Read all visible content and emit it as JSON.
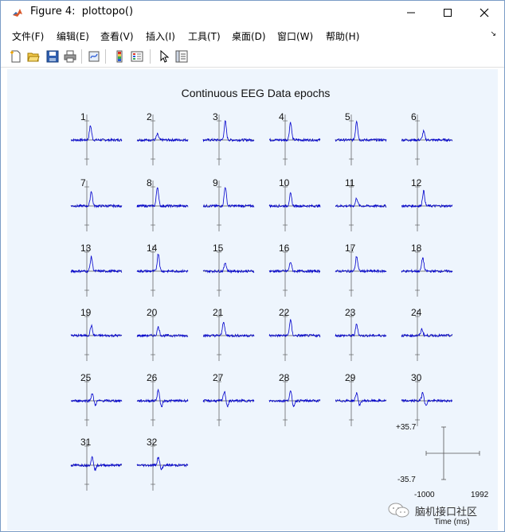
{
  "window": {
    "title": "Figure 4:  plottopo()",
    "controls": [
      "minimize",
      "maximize",
      "close"
    ]
  },
  "menu": {
    "items": [
      "文件(F)",
      "编辑(E)",
      "查看(V)",
      "插入(I)",
      "工具(T)",
      "桌面(D)",
      "窗口(W)",
      "帮助(H)"
    ],
    "overflow_arrow": "↘"
  },
  "toolbar": {
    "buttons": [
      "new-figure-icon",
      "open-icon",
      "save-icon",
      "print-icon",
      "link-icon",
      "colorbar-icon",
      "legend-icon",
      "pointer-icon",
      "property-editor-icon"
    ]
  },
  "figure": {
    "title": "Continuous EEG Data epochs",
    "channels": [
      "1",
      "2",
      "3",
      "4",
      "5",
      "6",
      "7",
      "8",
      "9",
      "10",
      "11",
      "12",
      "13",
      "14",
      "15",
      "16",
      "17",
      "18",
      "19",
      "20",
      "21",
      "22",
      "23",
      "24",
      "25",
      "26",
      "27",
      "28",
      "29",
      "30",
      "31",
      "32"
    ],
    "trace_color": "#0000cc",
    "axis_color": "#555555",
    "scale": {
      "y_max": "+35.7",
      "y_min": "-35.7",
      "x_min": "-1000",
      "x_max": "1992",
      "x_label": "Time (ms)"
    }
  },
  "chart_data": {
    "type": "line",
    "title": "Continuous EEG Data epochs",
    "xlabel": "Time (ms)",
    "xlim": [
      -1000,
      1992
    ],
    "ylim": [
      -35.7,
      35.7
    ],
    "series": [
      {
        "name": "1",
        "peak_latency_ms": 150,
        "peak_amp": 20
      },
      {
        "name": "2",
        "peak_latency_ms": 200,
        "peak_amp": 8
      },
      {
        "name": "3",
        "peak_latency_ms": 300,
        "peak_amp": 26
      },
      {
        "name": "4",
        "peak_latency_ms": 250,
        "peak_amp": 25
      },
      {
        "name": "5",
        "peak_latency_ms": 250,
        "peak_amp": 27
      },
      {
        "name": "6",
        "peak_latency_ms": 300,
        "peak_amp": 12
      },
      {
        "name": "7",
        "peak_latency_ms": 200,
        "peak_amp": 21
      },
      {
        "name": "8",
        "peak_latency_ms": 200,
        "peak_amp": 27
      },
      {
        "name": "9",
        "peak_latency_ms": 300,
        "peak_amp": 27
      },
      {
        "name": "10",
        "peak_latency_ms": 250,
        "peak_amp": 17
      },
      {
        "name": "11",
        "peak_latency_ms": 250,
        "peak_amp": 11
      },
      {
        "name": "12",
        "peak_latency_ms": 300,
        "peak_amp": 21
      },
      {
        "name": "13",
        "peak_latency_ms": 200,
        "peak_amp": 20
      },
      {
        "name": "14",
        "peak_latency_ms": 250,
        "peak_amp": 25
      },
      {
        "name": "15",
        "peak_latency_ms": 300,
        "peak_amp": 12
      },
      {
        "name": "16",
        "peak_latency_ms": 250,
        "peak_amp": 13
      },
      {
        "name": "17",
        "peak_latency_ms": 250,
        "peak_amp": 21
      },
      {
        "name": "18",
        "peak_latency_ms": 250,
        "peak_amp": 19
      },
      {
        "name": "19",
        "peak_latency_ms": 200,
        "peak_amp": 14
      },
      {
        "name": "20",
        "peak_latency_ms": 250,
        "peak_amp": 12
      },
      {
        "name": "21",
        "peak_latency_ms": 200,
        "peak_amp": 20
      },
      {
        "name": "22",
        "peak_latency_ms": 250,
        "peak_amp": 22
      },
      {
        "name": "23",
        "peak_latency_ms": 250,
        "peak_amp": 16
      },
      {
        "name": "24",
        "peak_latency_ms": 200,
        "peak_amp": 9
      },
      {
        "name": "25",
        "peak_latency_ms": 250,
        "peak_amp": 10
      },
      {
        "name": "26",
        "peak_latency_ms": 250,
        "peak_amp": 15
      },
      {
        "name": "27",
        "peak_latency_ms": 250,
        "peak_amp": 13
      },
      {
        "name": "28",
        "peak_latency_ms": 250,
        "peak_amp": 13
      },
      {
        "name": "29",
        "peak_latency_ms": 250,
        "peak_amp": 11
      },
      {
        "name": "30",
        "peak_latency_ms": 250,
        "peak_amp": 12
      },
      {
        "name": "31",
        "peak_latency_ms": 250,
        "peak_amp": 11
      },
      {
        "name": "32",
        "peak_latency_ms": 250,
        "peak_amp": 11
      }
    ]
  },
  "watermark": {
    "text": "脑机接口社区"
  }
}
